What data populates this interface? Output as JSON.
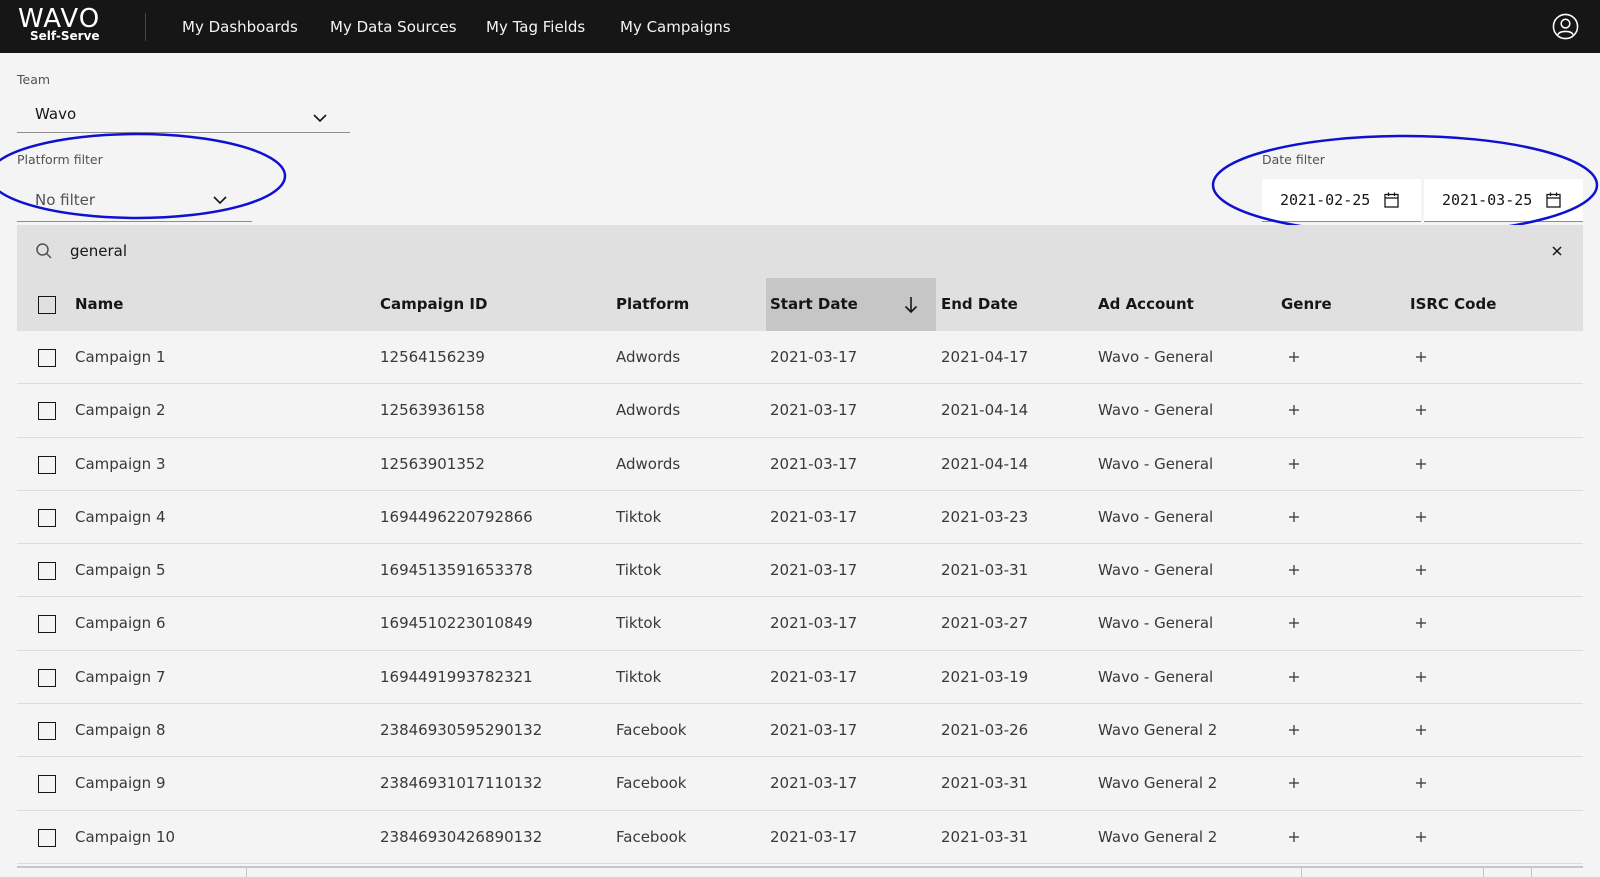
{
  "header": {
    "logo_main": "WAVO",
    "logo_sub": "Self-Serve",
    "nav": [
      "My Dashboards",
      "My Data Sources",
      "My Tag Fields",
      "My Campaigns"
    ]
  },
  "filters": {
    "team_label": "Team",
    "team_value": "Wavo",
    "platform_label": "Platform filter",
    "platform_value": "No filter",
    "date_label": "Date filter",
    "date_start": "2021-02-25",
    "date_end": "2021-03-25"
  },
  "search": {
    "value": "general"
  },
  "table": {
    "columns": [
      "Name",
      "Campaign ID",
      "Platform",
      "Start Date",
      "End Date",
      "Ad Account",
      "Genre",
      "ISRC Code"
    ],
    "sorted_column": "Start Date",
    "rows": [
      {
        "name": "Campaign 1",
        "id": "12564156239",
        "platform": "Adwords",
        "start": "2021-03-17",
        "end": "2021-04-17",
        "account": "Wavo - General"
      },
      {
        "name": "Campaign 2",
        "id": "12563936158",
        "platform": "Adwords",
        "start": "2021-03-17",
        "end": "2021-04-14",
        "account": "Wavo - General"
      },
      {
        "name": "Campaign 3",
        "id": "12563901352",
        "platform": "Adwords",
        "start": "2021-03-17",
        "end": "2021-04-14",
        "account": "Wavo - General"
      },
      {
        "name": "Campaign 4",
        "id": "1694496220792866",
        "platform": "Tiktok",
        "start": "2021-03-17",
        "end": "2021-03-23",
        "account": "Wavo - General"
      },
      {
        "name": "Campaign 5",
        "id": "1694513591653378",
        "platform": "Tiktok",
        "start": "2021-03-17",
        "end": "2021-03-31",
        "account": "Wavo - General"
      },
      {
        "name": "Campaign 6",
        "id": "1694510223010849",
        "platform": "Tiktok",
        "start": "2021-03-17",
        "end": "2021-03-27",
        "account": "Wavo - General"
      },
      {
        "name": "Campaign 7",
        "id": "1694491993782321",
        "platform": "Tiktok",
        "start": "2021-03-17",
        "end": "2021-03-19",
        "account": "Wavo - General"
      },
      {
        "name": "Campaign 8",
        "id": "23846930595290132",
        "platform": "Facebook",
        "start": "2021-03-17",
        "end": "2021-03-26",
        "account": "Wavo General 2"
      },
      {
        "name": "Campaign 9",
        "id": "23846931017110132",
        "platform": "Facebook",
        "start": "2021-03-17",
        "end": "2021-03-31",
        "account": "Wavo General 2"
      },
      {
        "name": "Campaign 10",
        "id": "23846930426890132",
        "platform": "Facebook",
        "start": "2021-03-17",
        "end": "2021-03-31",
        "account": "Wavo General 2"
      }
    ]
  },
  "colors": {
    "header_bg": "#161616",
    "annotation": "#1010d0",
    "page_bg": "#f4f4f4"
  }
}
